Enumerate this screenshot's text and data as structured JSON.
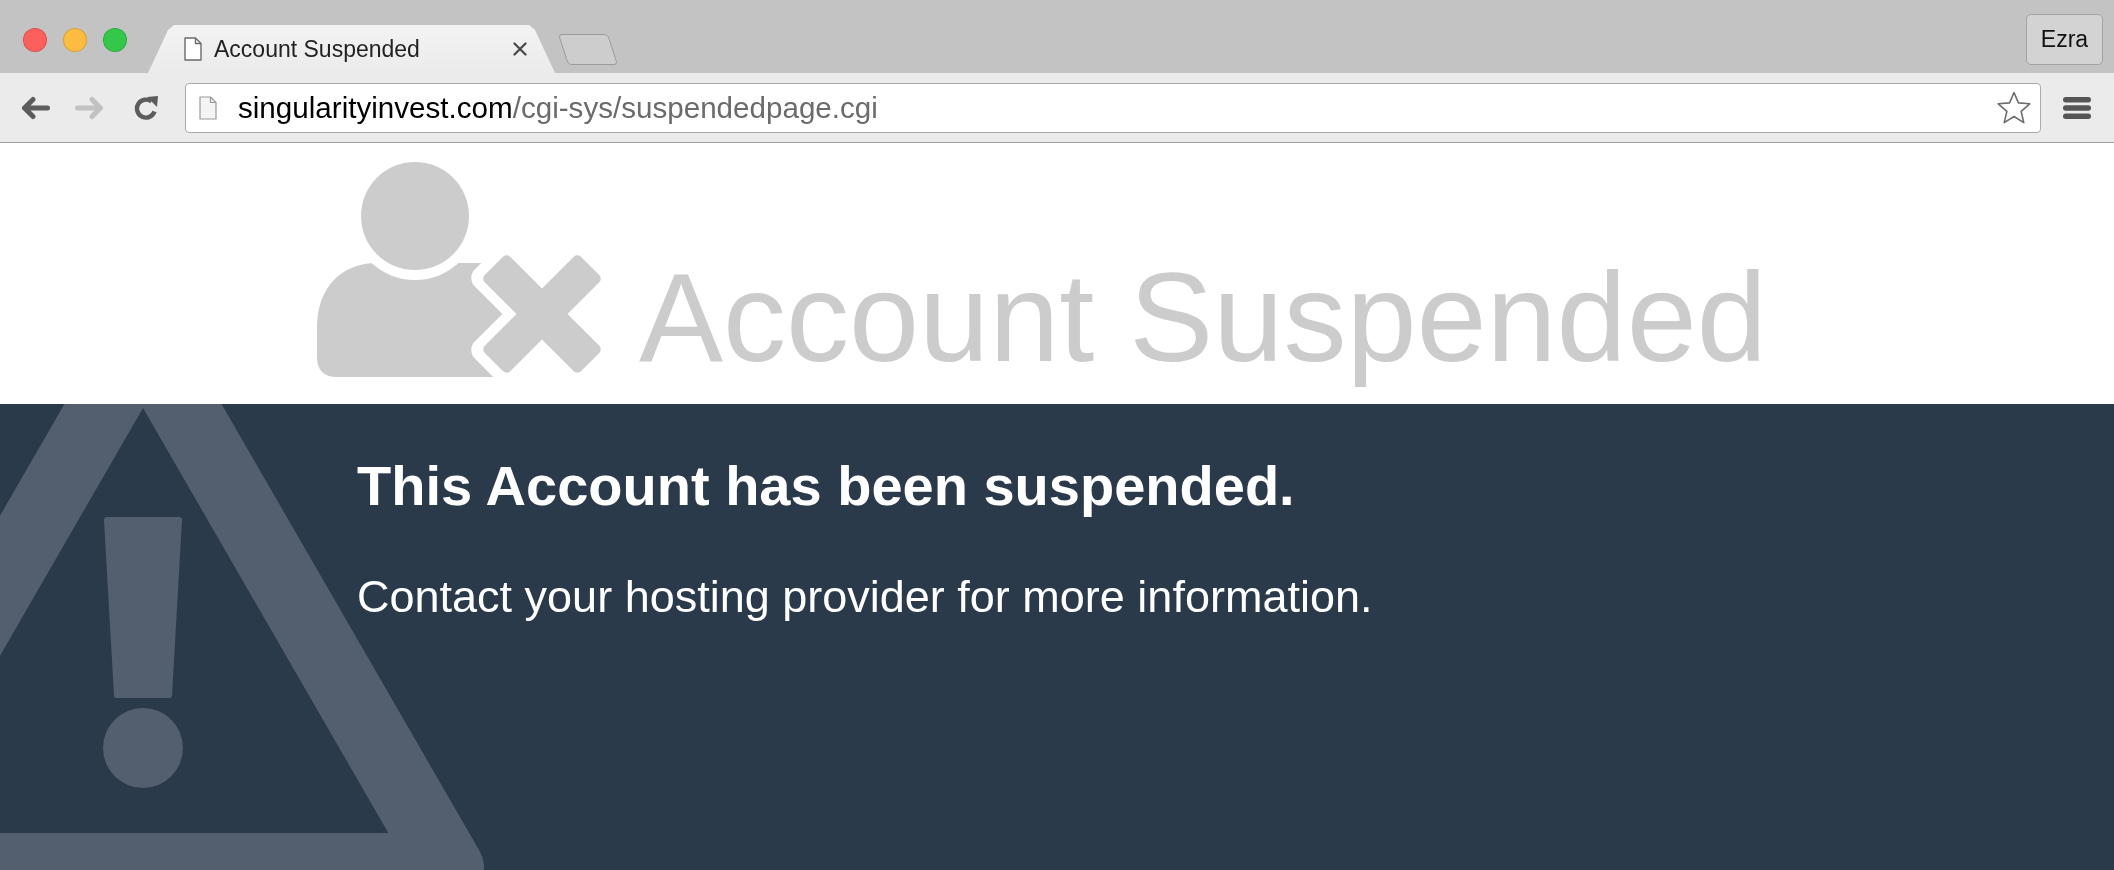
{
  "window_controls": [
    {
      "kind": "close"
    },
    {
      "kind": "minimize"
    },
    {
      "kind": "zoom"
    }
  ],
  "tabs": [
    {
      "title": "Account Suspended",
      "selected": true
    }
  ],
  "profile_button": {
    "label": "Ezra"
  },
  "toolbar": {
    "nav_buttons": [
      {
        "kind": "back",
        "disabled": false
      },
      {
        "kind": "forward",
        "disabled": true
      },
      {
        "kind": "reload",
        "disabled": false
      }
    ],
    "address_bar": {
      "host": "singularityinvest.com",
      "path": "/cgi-sys/suspendedpage.cgi"
    }
  },
  "page": {
    "banner_title": "Account Suspended",
    "heading": "This Account has been suspended.",
    "message": "Contact your hosting provider for more information."
  }
}
